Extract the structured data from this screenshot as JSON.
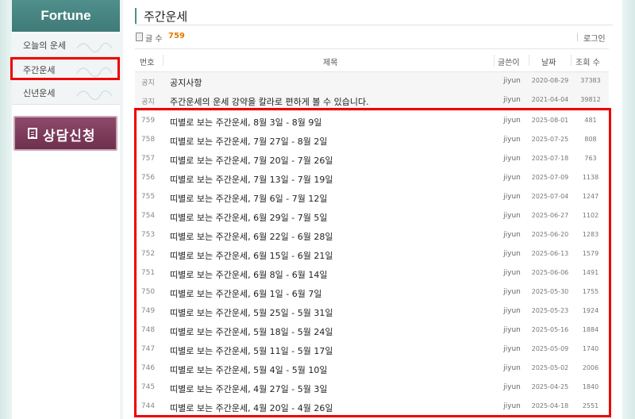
{
  "sidebar": {
    "header": "Fortune",
    "items": [
      {
        "label": "오늘의 운세"
      },
      {
        "label": "주간운세"
      },
      {
        "label": "신년운세"
      }
    ],
    "consult_button": "상담신청"
  },
  "board": {
    "title": "주간운세",
    "count_label": "글 수",
    "count": "759",
    "login": "로그인",
    "columns": {
      "num": "번호",
      "title": "제목",
      "writer": "글쓴이",
      "date": "날짜",
      "views": "조회 수"
    },
    "notices": [
      {
        "num": "공지",
        "title": "공지사항",
        "writer": "jiyun",
        "date": "2020-08-29",
        "views": "37383"
      },
      {
        "num": "공지",
        "title": "주간운세의 운세 강약을 칼라로 편하게 볼 수 있습니다.",
        "writer": "jiyun",
        "date": "2021-04-04",
        "views": "39812"
      }
    ],
    "posts": [
      {
        "num": "759",
        "title": "띠별로 보는 주간운세, 8월 3일 - 8월 9일",
        "writer": "jiyun",
        "date": "2025-08-01",
        "views": "481"
      },
      {
        "num": "758",
        "title": "띠별로 보는 주간운세, 7월 27일 - 8월 2일",
        "writer": "jiyun",
        "date": "2025-07-25",
        "views": "808"
      },
      {
        "num": "757",
        "title": "띠별로 보는 주간운세, 7월 20일 - 7월 26일",
        "writer": "jiyun",
        "date": "2025-07-18",
        "views": "763"
      },
      {
        "num": "756",
        "title": "띠별로 보는 주간운세, 7월 13일 - 7월 19일",
        "writer": "jiyun",
        "date": "2025-07-09",
        "views": "1138"
      },
      {
        "num": "755",
        "title": "띠별로 보는 주간운세, 7월 6일 - 7월 12일",
        "writer": "jiyun",
        "date": "2025-07-04",
        "views": "1247"
      },
      {
        "num": "754",
        "title": "띠별로 보는 주간운세, 6월 29일 - 7월 5일",
        "writer": "jiyun",
        "date": "2025-06-27",
        "views": "1102"
      },
      {
        "num": "753",
        "title": "띠별로 보는 주간운세, 6월 22일 - 6월 28일",
        "writer": "jiyun",
        "date": "2025-06-20",
        "views": "1283"
      },
      {
        "num": "752",
        "title": "띠별로 보는 주간운세, 6월 15일 - 6월 21일",
        "writer": "jiyun",
        "date": "2025-06-13",
        "views": "1579"
      },
      {
        "num": "751",
        "title": "띠별로 보는 주간운세, 6월 8일 - 6월 14일",
        "writer": "jiyun",
        "date": "2025-06-06",
        "views": "1491"
      },
      {
        "num": "750",
        "title": "띠별로 보는 주간운세, 6월 1일 - 6월 7일",
        "writer": "jiyun",
        "date": "2025-05-30",
        "views": "1755"
      },
      {
        "num": "749",
        "title": "띠별로 보는 주간운세, 5월 25일 - 5월 31일",
        "writer": "jiyun",
        "date": "2025-05-23",
        "views": "1924"
      },
      {
        "num": "748",
        "title": "띠별로 보는 주간운세, 5월 18일 - 5월 24일",
        "writer": "jiyun",
        "date": "2025-05-16",
        "views": "1884"
      },
      {
        "num": "747",
        "title": "띠별로 보는 주간운세, 5월 11일 - 5월 17일",
        "writer": "jiyun",
        "date": "2025-05-09",
        "views": "1740"
      },
      {
        "num": "746",
        "title": "띠별로 보는 주간운세, 5월 4일 - 5월 10일",
        "writer": "jiyun",
        "date": "2025-05-02",
        "views": "2006"
      },
      {
        "num": "745",
        "title": "띠별로 보는 주간운세, 4월 27일 - 5월 3일",
        "writer": "jiyun",
        "date": "2025-04-25",
        "views": "1840"
      },
      {
        "num": "744",
        "title": "띠별로 보는 주간운세, 4월 20일 - 4월 26일",
        "writer": "jiyun",
        "date": "2025-04-18",
        "views": "2551"
      }
    ]
  },
  "colors": {
    "accent": "#4f8f8c",
    "highlight": "#e00000",
    "count": "#e07a00",
    "consult": "#7a3858"
  }
}
